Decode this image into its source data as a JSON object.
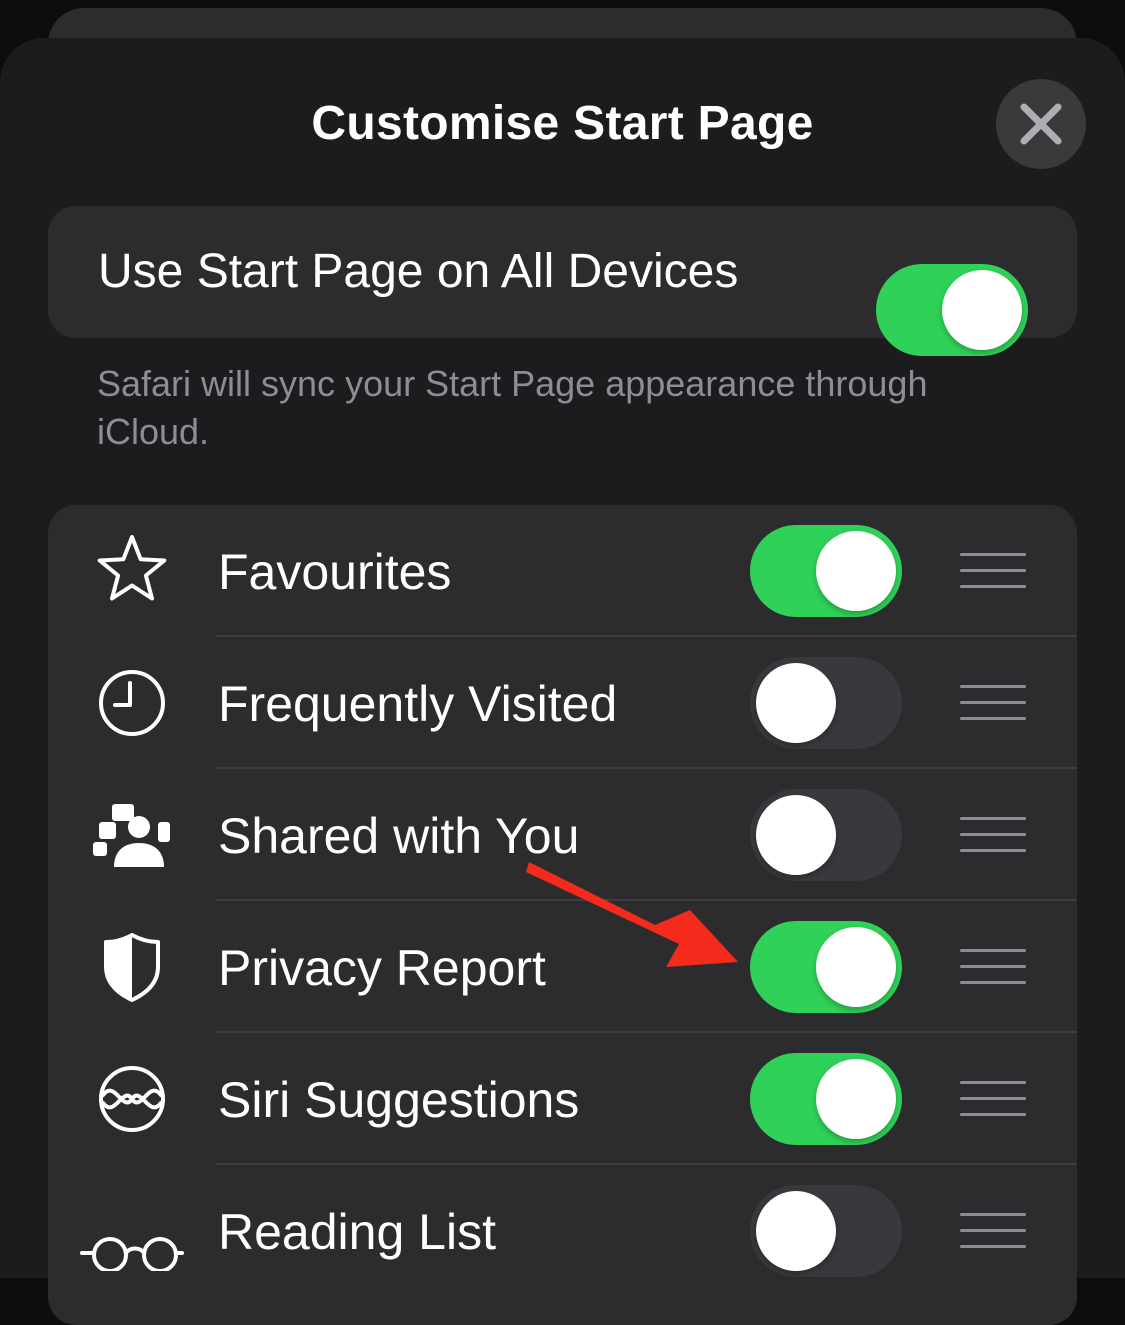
{
  "sheet": {
    "title": "Customise Start Page",
    "close_icon": "xmark-icon"
  },
  "sync": {
    "label": "Use Start Page on All Devices",
    "enabled": true,
    "footer": "Safari will sync your Start Page appearance through iCloud."
  },
  "sections": [
    {
      "label": "Favourites",
      "icon": "star-icon",
      "enabled": true
    },
    {
      "label": "Frequently Visited",
      "icon": "clock-icon",
      "enabled": false
    },
    {
      "label": "Shared with You",
      "icon": "shared-with-you-icon",
      "enabled": false
    },
    {
      "label": "Privacy Report",
      "icon": "shield-icon",
      "enabled": true
    },
    {
      "label": "Siri Suggestions",
      "icon": "siri-icon",
      "enabled": true
    },
    {
      "label": "Reading List",
      "icon": "glasses-icon",
      "enabled": false
    }
  ],
  "colors": {
    "switch_on": "#30d158",
    "switch_off": "#39393d",
    "annotation_arrow": "#f42b1c"
  },
  "annotation": {
    "icon": "red-arrow-icon"
  }
}
